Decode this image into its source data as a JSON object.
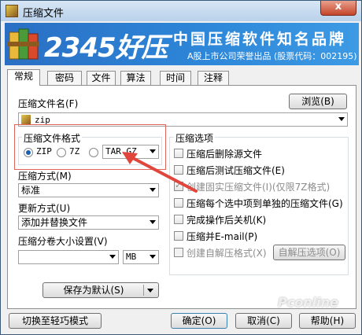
{
  "window": {
    "title": "压缩文件",
    "close_label": "x"
  },
  "banner": {
    "logo": "2345好压",
    "slogan": "中国压缩软件知名品牌",
    "sub": "A股上市公司荣誉出品 (股票代码：002195)"
  },
  "tabs": [
    "常规",
    "密码",
    "文件",
    "算法",
    "时间",
    "注释"
  ],
  "general": {
    "filename_label": "压缩文件名(F)",
    "browse_label": "浏览(B)",
    "filename_value": "zip",
    "format_group_title": "压缩文件格式",
    "formats": [
      "ZIP",
      "7Z",
      "TAR.GZ"
    ],
    "method_label": "压缩方式(M)",
    "method_value": "标准",
    "update_label": "更新方式(U)",
    "update_value": "添加并替换文件",
    "split_label": "压缩分卷大小设置(V)",
    "split_value": "",
    "split_unit": "MB",
    "default_label": "保存为默认(S)"
  },
  "options": {
    "title": "压缩选项",
    "items": [
      {
        "label": "压缩后删除源文件",
        "checked": false,
        "disabled": false
      },
      {
        "label": "压缩后测试压缩文件(E)",
        "checked": false,
        "disabled": false
      },
      {
        "label": "创建固实压缩文件(I)(仅限7Z格式)",
        "checked": true,
        "disabled": true
      },
      {
        "label": "压缩每个选中项到单独的压缩文件(G)",
        "checked": false,
        "disabled": false
      },
      {
        "label": "完成操作后关机(K)",
        "checked": false,
        "disabled": false
      },
      {
        "label": "压缩并E-mail(P)",
        "checked": false,
        "disabled": false
      },
      {
        "label": "创建自解压格式(X)",
        "checked": false,
        "disabled": true
      }
    ],
    "sfx_button": "自解压选项(O)"
  },
  "footer": {
    "light_mode": "切换至轻巧模式",
    "ok": "确定(O)",
    "cancel": "取消(C)",
    "help": "帮助(H)"
  },
  "watermark": "Pconline",
  "colors": {
    "accent": "#1a5fb4",
    "highlight": "#e0645a",
    "banner": "#2a6fc4"
  }
}
